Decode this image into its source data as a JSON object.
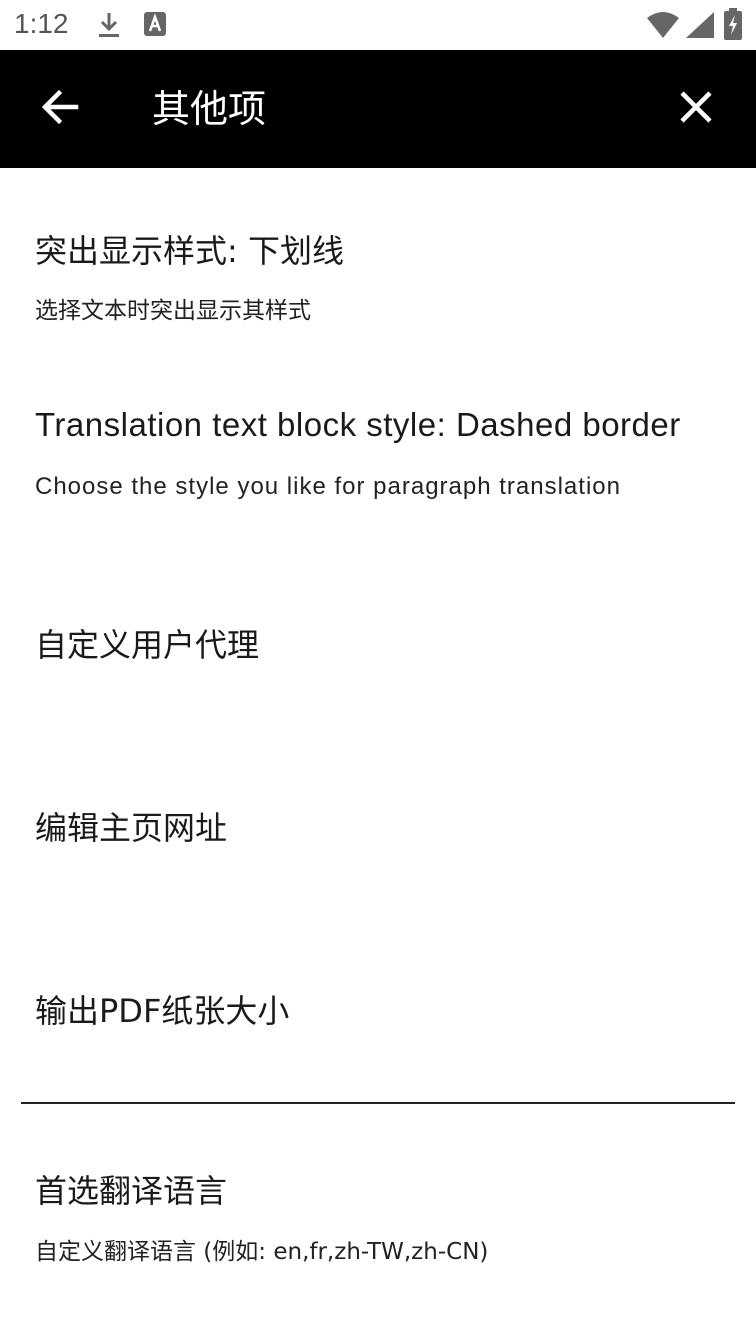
{
  "status_bar": {
    "time": "1:12",
    "icons": [
      "download-icon",
      "text-a-icon",
      "wifi-icon",
      "signal-icon",
      "battery-charging-icon"
    ]
  },
  "app_bar": {
    "title": "其他项",
    "back_icon": "arrow-left-icon",
    "close_icon": "close-icon"
  },
  "preferences": [
    {
      "title": "突出显示样式: 下划线",
      "summary": "选择文本时突出显示其样式"
    },
    {
      "title": "Translation text block style: Dashed border",
      "summary": "Choose the style you like for paragraph translation"
    },
    {
      "title": "自定义用户代理",
      "summary": ""
    },
    {
      "title": "编辑主页网址",
      "summary": ""
    },
    {
      "title": "输出PDF纸张大小",
      "summary": ""
    },
    {
      "title": "首选翻译语言",
      "summary": "自定义翻译语言 (例如: en,fr,zh-TW,zh-CN)"
    }
  ],
  "colors": {
    "app_bar_bg": "#000000",
    "background": "#ffffff",
    "text": "#1a1a1a"
  }
}
